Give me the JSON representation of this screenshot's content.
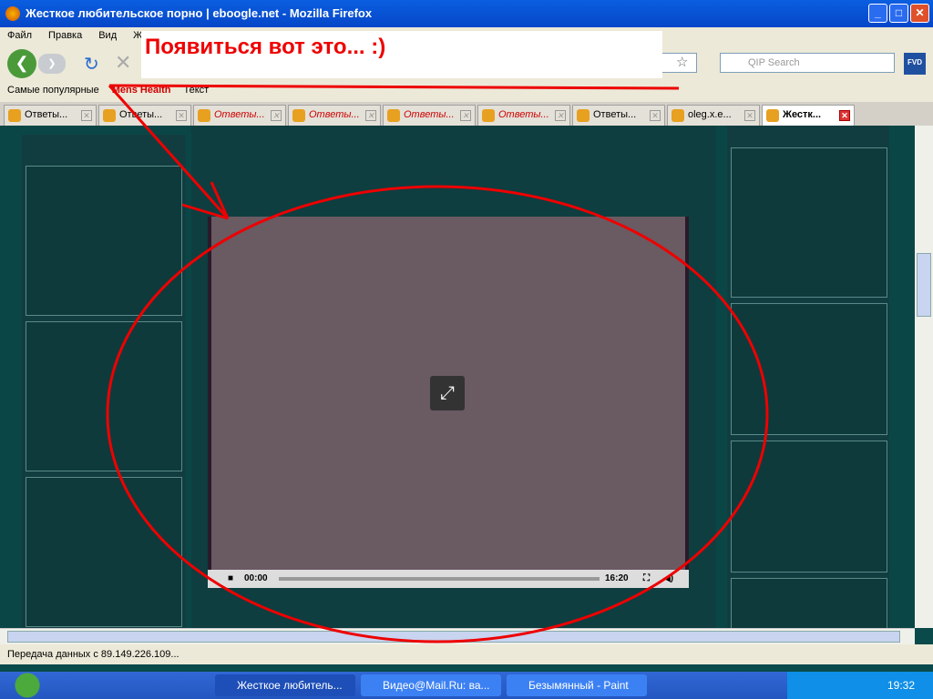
{
  "window": {
    "title": "Жесткое любительское порно | eboogle.net - Mozilla Firefox"
  },
  "menu": [
    "Файл",
    "Правка",
    "Вид",
    "Жу"
  ],
  "search": {
    "placeholder": "QIP Search"
  },
  "bookmarks": [
    "Самые популярные",
    "Mens Health",
    "Текст"
  ],
  "tabs": [
    {
      "label": "Ответы...",
      "red": false
    },
    {
      "label": "Ответы...",
      "red": false
    },
    {
      "label": "Ответы...",
      "red": true
    },
    {
      "label": "Ответы...",
      "red": true
    },
    {
      "label": "Ответы...",
      "red": true
    },
    {
      "label": "Ответы...",
      "red": true
    },
    {
      "label": "Ответы...",
      "red": false
    },
    {
      "label": "oleg.x.e...",
      "red": false
    },
    {
      "label": "Жестк...",
      "red": false,
      "active": true
    }
  ],
  "annotation": {
    "text": "Появиться вот это... :)",
    "color": "#ee0000"
  },
  "player": {
    "current": "00:00",
    "duration": "16:20"
  },
  "status": "Передача данных с 89.149.226.109...",
  "taskbar": {
    "items": [
      "Жесткое любитель...",
      "Видео@Mail.Ru: ва...",
      "Безымянный - Paint"
    ],
    "clock": "19:32"
  }
}
